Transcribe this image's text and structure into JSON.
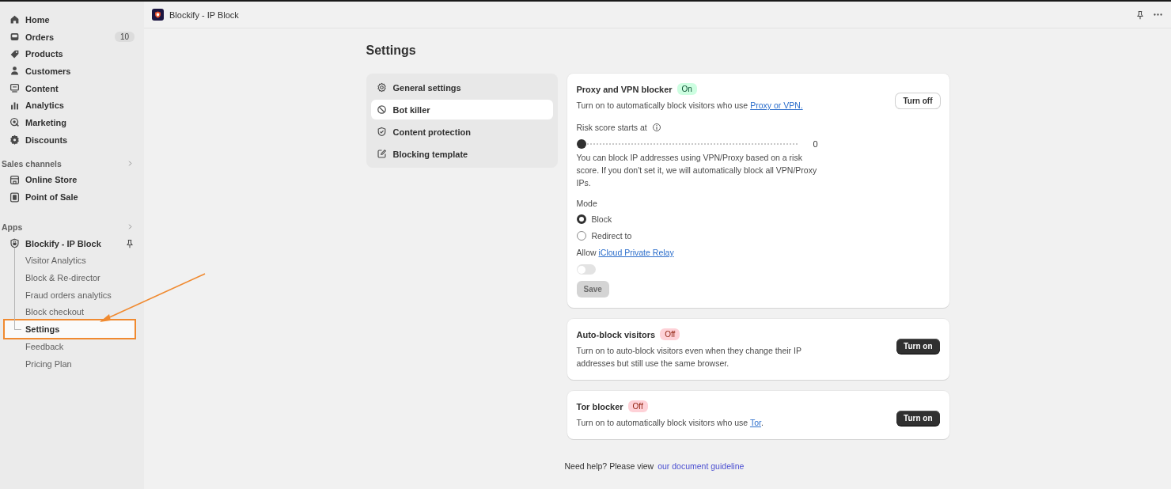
{
  "sidebar": {
    "items": [
      {
        "label": "Home",
        "selected": false
      },
      {
        "label": "Orders",
        "selected": false,
        "badge": "10"
      },
      {
        "label": "Products",
        "selected": false
      },
      {
        "label": "Customers",
        "selected": false
      },
      {
        "label": "Content",
        "selected": false
      },
      {
        "label": "Analytics",
        "selected": false
      },
      {
        "label": "Marketing",
        "selected": false
      },
      {
        "label": "Discounts",
        "selected": false
      }
    ],
    "sections": [
      {
        "title": "Sales channels",
        "items": [
          {
            "label": "Online Store",
            "selected": false
          },
          {
            "label": "Point of Sale",
            "selected": false
          }
        ]
      },
      {
        "title": "Apps",
        "items": [
          {
            "label": "Blockify - IP Block",
            "selected": false,
            "children": [
              {
                "label": "Visitor Analytics",
                "selected": false,
                "highlighted": false
              },
              {
                "label": "Block & Re-director",
                "selected": false,
                "highlighted": false
              },
              {
                "label": "Fraud orders analytics",
                "selected": false,
                "highlighted": false
              },
              {
                "label": "Block checkout",
                "selected": false,
                "highlighted": false
              },
              {
                "label": "Settings",
                "selected": true,
                "highlighted": true
              },
              {
                "label": "Feedback",
                "selected": false,
                "highlighted": false
              },
              {
                "label": "Pricing Plan",
                "selected": false,
                "highlighted": false
              }
            ]
          }
        ]
      }
    ]
  },
  "topbar": {
    "title": "Blockify - IP Block"
  },
  "page": {
    "title": "Settings",
    "nav": [
      {
        "label": "General settings",
        "selected": false
      },
      {
        "label": "Bot killer",
        "selected": true
      },
      {
        "label": "Content protection",
        "selected": false
      },
      {
        "label": "Blocking template",
        "selected": false
      }
    ],
    "cards": [
      {
        "kind": "detailed",
        "title": "Proxy and VPN blocker",
        "status": {
          "label": "On",
          "on": true
        },
        "description": "Turn on to automatically block visitors who use ",
        "link": "Proxy or VPN.",
        "button": "Turn off",
        "settings": {
          "risk_label": "Risk score starts at",
          "level": 0,
          "reading": "0",
          "help": "You can block IP addresses using VPN/Proxy based on a risk score. If you don't set it, we will automatically block all VPN/Proxy IPs.",
          "mode_label": "Mode",
          "modes": [
            {
              "label": "Block",
              "selected": true
            },
            {
              "label": "Redirect to",
              "selected": false
            }
          ],
          "allow_text": "Allow",
          "allow_link": "iCloud Private Relay",
          "allow_on": false,
          "save": {
            "label": "Save",
            "disabled": true
          }
        }
      },
      {
        "kind": "simple",
        "title": "Auto-block visitors",
        "status": {
          "label": "Off",
          "on": false
        },
        "description": "Turn on to auto-block visitors even when they change their IP addresses but still use the same browser.",
        "button": "Turn on"
      },
      {
        "kind": "simple",
        "title": "Tor blocker",
        "status": {
          "label": "Off",
          "on": false
        },
        "description": "Turn on to automatically block visitors who use ",
        "link": "Tor",
        "description_end": ".",
        "button": "Turn on"
      }
    ],
    "footer": {
      "text": "Need help? Please view",
      "link": "our document guideline"
    }
  }
}
